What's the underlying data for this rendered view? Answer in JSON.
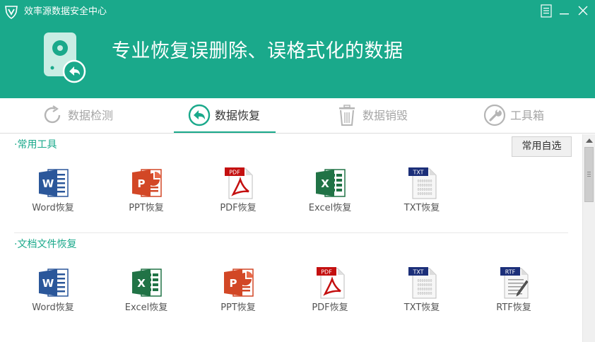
{
  "window": {
    "title": "效率源数据安全中心",
    "brand_color": "#1aa98b"
  },
  "banner": {
    "heading": "专业恢复误删除、误格式化的数据",
    "icon": "disk-restore-icon"
  },
  "tabs": [
    {
      "label": "数据检测",
      "icon": "refresh-icon",
      "active": false
    },
    {
      "label": "数据恢复",
      "icon": "restore-arrow-icon",
      "active": true
    },
    {
      "label": "数据销毁",
      "icon": "trash-icon",
      "active": false
    },
    {
      "label": "工具箱",
      "icon": "wrench-icon",
      "active": false
    }
  ],
  "sections": [
    {
      "title": "·常用工具",
      "action_label": "常用自选",
      "tools": [
        {
          "label": "Word恢复",
          "icon": "word-icon"
        },
        {
          "label": "PPT恢复",
          "icon": "ppt-icon"
        },
        {
          "label": "PDF恢复",
          "icon": "pdf-icon"
        },
        {
          "label": "Excel恢复",
          "icon": "excel-icon"
        },
        {
          "label": "TXT恢复",
          "icon": "txt-icon"
        }
      ]
    },
    {
      "title": "·文档文件恢复",
      "tools": [
        {
          "label": "Word恢复",
          "icon": "word-icon"
        },
        {
          "label": "Excel恢复",
          "icon": "excel-icon"
        },
        {
          "label": "PPT恢复",
          "icon": "ppt-icon"
        },
        {
          "label": "PDF恢复",
          "icon": "pdf-icon"
        },
        {
          "label": "TXT恢复",
          "icon": "txt-icon"
        },
        {
          "label": "RTF恢复",
          "icon": "rtf-icon"
        }
      ]
    }
  ]
}
